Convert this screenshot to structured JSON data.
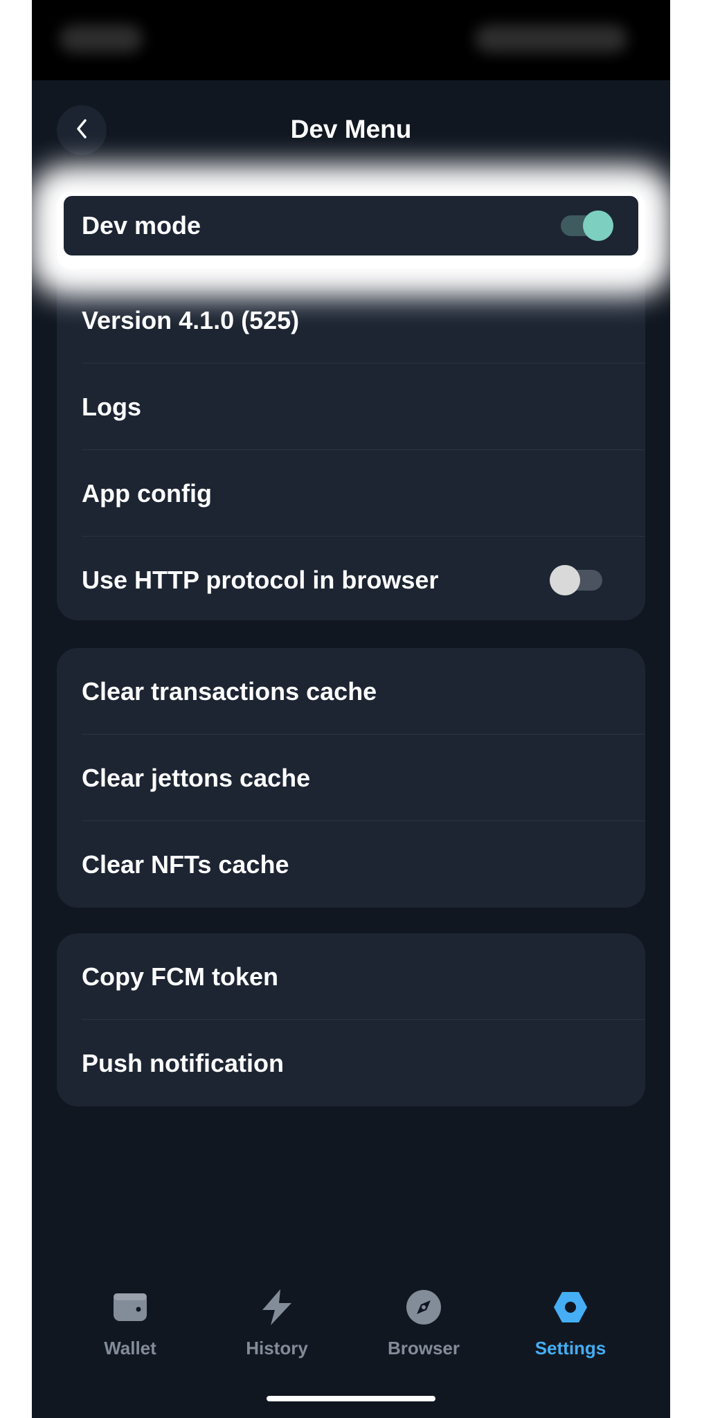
{
  "header": {
    "title": "Dev Menu",
    "back_icon": "chevron-left-icon"
  },
  "highlighted": {
    "dev_mode_label": "Dev mode",
    "dev_mode_enabled": true
  },
  "group1": {
    "version": "Version 4.1.0 (525)",
    "logs": "Logs",
    "app_config": "App config",
    "http_label": "Use HTTP protocol in browser",
    "http_enabled": false
  },
  "group2": {
    "clear_transactions": "Clear transactions cache",
    "clear_jettons": "Clear jettons cache",
    "clear_nfts": "Clear NFTs cache"
  },
  "group3": {
    "copy_fcm": "Copy FCM token",
    "push_notification": "Push notification"
  },
  "tabs": [
    {
      "label": "Wallet",
      "icon": "wallet-icon",
      "active": false
    },
    {
      "label": "History",
      "icon": "lightning-icon",
      "active": false
    },
    {
      "label": "Browser",
      "icon": "compass-icon",
      "active": false
    },
    {
      "label": "Settings",
      "icon": "gear-icon",
      "active": true
    }
  ],
  "colors": {
    "background": "#111721",
    "card": "#1d2533",
    "accent": "#45aef5",
    "toggle_on": "#7dcfc0"
  }
}
